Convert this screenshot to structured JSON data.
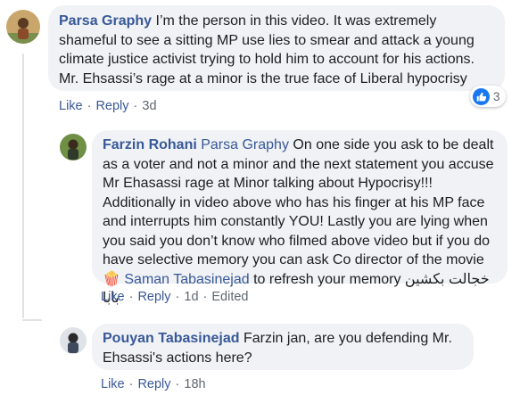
{
  "comments": [
    {
      "author": "Parsa Graphy",
      "text": "I’m the person in this video. It was extremely shameful to see a sitting MP use lies to smear and attack a young climate justice activist trying to hold him to account for his actions. Mr. Ehsassi’s rage at a minor is the true face of Liberal hypocrisy",
      "actions": {
        "like": "Like",
        "reply": "Reply",
        "time": "3d"
      },
      "reactions": {
        "icon": "thumbs-up-icon",
        "count": "3"
      }
    },
    {
      "author": "Farzin Rohani",
      "mention": "Parsa Graphy",
      "text": "On one side you ask to be dealt as a voter and not a minor and the next statement you accuse Mr Ehasassi rage at Minor talking about Hypocrisy!!! Additionally in video above who has his finger at his MP face and interrupts him constantly YOU! Lastly you are lying when you said you don’t know who filmed above video but if you do have selective memory you can ask Co director of the movie",
      "emoji": "🍿",
      "mention2": "Saman Tabasinejad",
      "text2": "to refresh your memory",
      "text_rtl": "خجالت بکشین بابا",
      "actions": {
        "like": "Like",
        "reply": "Reply",
        "time": "1d",
        "edited": "Edited"
      }
    },
    {
      "author": "Pouyan Tabasinejad",
      "text": "Farzin jan, are you defending Mr. Ehsassi's actions here?",
      "actions": {
        "like": "Like",
        "reply": "Reply",
        "time": "18h"
      }
    }
  ],
  "colors": {
    "link": "#385898",
    "bubble": "#f0f2f5",
    "like_blue": "#1877f2",
    "meta": "#606770"
  }
}
